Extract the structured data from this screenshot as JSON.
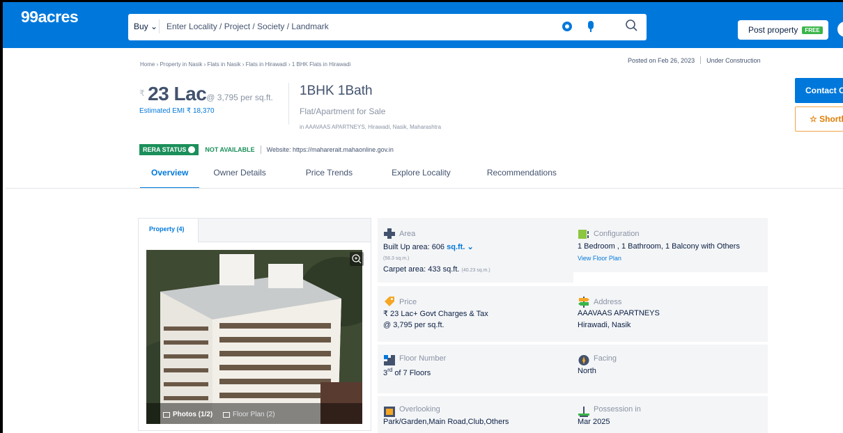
{
  "header": {
    "logo": "99acres",
    "search": {
      "buy_label": "Buy",
      "placeholder": "Enter Locality / Project / Society / Landmark"
    },
    "post_property": "Post property",
    "free_badge": "FREE"
  },
  "breadcrumb": "Home › Property in Nasik › Flats in Nasik › Flats in Hirawadi › 1 BHK Flats in Hirawadi",
  "posted": {
    "date": "Posted on Feb 26, 2023",
    "status": "Under Construction"
  },
  "price": {
    "currency": "₹",
    "amount": "23 Lac",
    "per_sqft": "@ 3,795 per sq.ft.",
    "emi": "Estimated EMI ₹ 18,370"
  },
  "config": {
    "title": "1BHK 1Bath",
    "subtitle": "Flat/Apartment for Sale",
    "address": "in AAAVAAS APARTNEYS, Hirawadi, Nasik, Maharashtra"
  },
  "rera": {
    "badge": "RERA STATUS",
    "status": "NOT AVAILABLE",
    "website": "Website: https://maharerait.mahaonline.gov.in"
  },
  "tabs": [
    "Overview",
    "Owner Details",
    "Price Trends",
    "Explore Locality",
    "Recommendations"
  ],
  "actions": {
    "contact": "Contact Owner",
    "shortlist": "Shortlist"
  },
  "gallery": {
    "tab": "Property (4)",
    "photos": "Photos (1/2)",
    "floor_plan": "Floor Plan (2)"
  },
  "details": {
    "area": {
      "label": "Area",
      "built_up": "Built Up area: 606",
      "unit": "sq.ft.",
      "built_up_sqm": "(56.3 sq.m.)",
      "carpet": "Carpet area: 433 sq.ft.",
      "carpet_sqm": "(40.23 sq.m.)"
    },
    "configuration": {
      "label": "Configuration",
      "value": "1 Bedroom , 1 Bathroom, 1 Balcony with Others",
      "link": "View Floor Plan"
    },
    "price": {
      "label": "Price",
      "line1": "₹ 23 Lac+ Govt Charges & Tax",
      "line2": "@ 3,795 per sq.ft."
    },
    "address": {
      "label": "Address",
      "line1": "AAAVAAS APARTNEYS",
      "line2": "Hirawadi, Nasik"
    },
    "floor": {
      "label": "Floor Number",
      "num": "3",
      "sup": "rd",
      "rest": "of 7 Floors"
    },
    "facing": {
      "label": "Facing",
      "value": "North"
    },
    "overlooking": {
      "label": "Overlooking",
      "value": "Park/Garden,Main Road,Club,Others"
    },
    "possession": {
      "label": "Possession in",
      "value": "Mar 2025"
    }
  },
  "colors": {
    "brand": "#0078db",
    "rera_green": "#1b8f5a",
    "shortlist_orange": "#e07c00"
  }
}
